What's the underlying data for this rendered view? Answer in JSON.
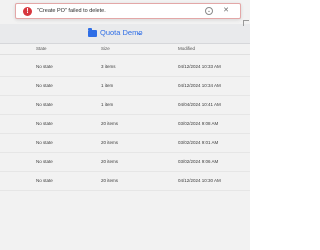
{
  "toast": {
    "message": "\"Create PO\" failed to delete.",
    "error_icon": "error-icon",
    "expand_icon": "chevron-down-icon",
    "close_icon": "close-icon"
  },
  "folder": {
    "title": "Quota Demo",
    "icon": "folder-icon",
    "chevron": "chevron-down-icon"
  },
  "table": {
    "columns": [
      "State",
      "Size",
      "Modified"
    ],
    "rows": [
      {
        "state": "No state",
        "size": "3 items",
        "modified": "04/12/2024 10:33 AM"
      },
      {
        "state": "No state",
        "size": "1 item",
        "modified": "04/12/2024 10:34 AM"
      },
      {
        "state": "No state",
        "size": "1 item",
        "modified": "04/04/2024 10:41 AM"
      },
      {
        "state": "No state",
        "size": "20 items",
        "modified": "03/02/2024 9:08 AM"
      },
      {
        "state": "No state",
        "size": "20 items",
        "modified": "03/02/2024 9:01 AM"
      },
      {
        "state": "No state",
        "size": "20 items",
        "modified": "03/02/2024 9:06 AM"
      },
      {
        "state": "No state",
        "size": "20 items",
        "modified": "04/12/2024 10:30 AM"
      }
    ]
  },
  "colors": {
    "accent": "#2f6ee6",
    "error": "#d7373f"
  }
}
